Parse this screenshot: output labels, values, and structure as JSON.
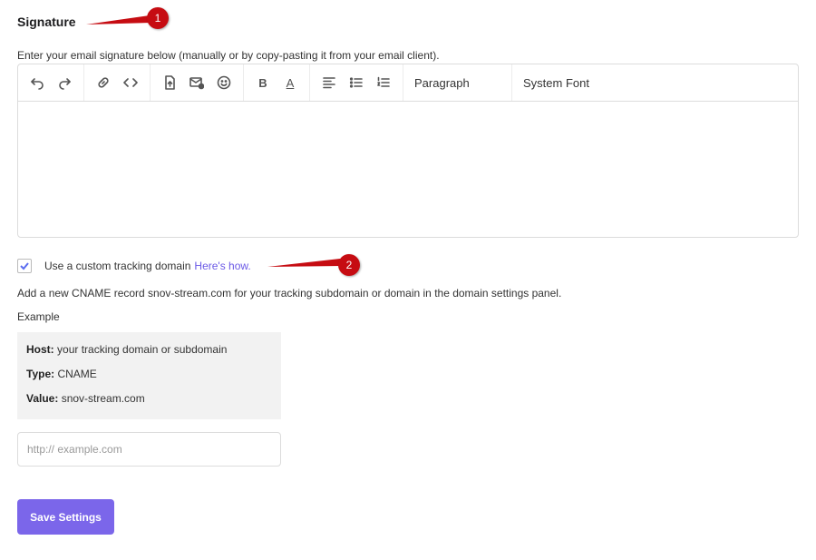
{
  "signature": {
    "title": "Signature",
    "description": "Enter your email signature below (manually or by copy-pasting it from your email client).",
    "toolbar": {
      "undo_icon": "undo-icon",
      "redo_icon": "redo-icon",
      "link_icon": "link-icon",
      "code_icon": "code-icon",
      "bold": "B",
      "text_color": "A",
      "paragraph": "Paragraph",
      "font": "System Font"
    }
  },
  "tracking": {
    "checked": true,
    "label": "Use a custom tracking domain",
    "link": "Here's how.",
    "cname_text": "Add a new CNAME record snov-stream.com for your tracking subdomain or domain in the domain settings panel.",
    "example_label": "Example",
    "example": [
      {
        "key": "Host:",
        "value": "your tracking domain or subdomain"
      },
      {
        "key": "Type:",
        "value": "CNAME"
      },
      {
        "key": "Value:",
        "value": "snov-stream.com"
      }
    ],
    "input_placeholder": "http:// example.com"
  },
  "save_button": "Save Settings",
  "annotations": {
    "marker_1": "1",
    "marker_2": "2"
  },
  "colors": {
    "accent": "#7b66ea",
    "link": "#6b59e6",
    "marker": "#c60c12"
  }
}
